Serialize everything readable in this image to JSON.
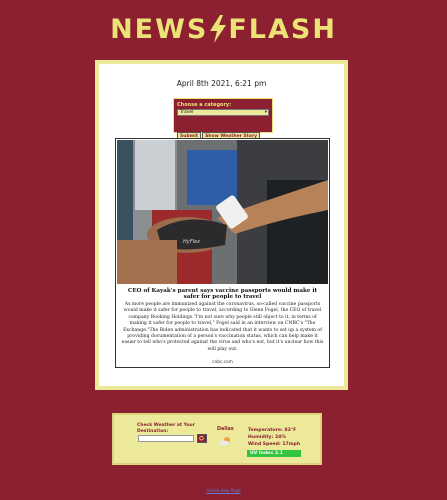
{
  "brand": {
    "left": "NEWS",
    "right": "FLASH",
    "color": "#ece377"
  },
  "datetime": "April 8th 2021, 6:21 pm",
  "category": {
    "label": "Choose a category:",
    "selected": "Travel",
    "submit_label": "Submit",
    "weather_story_label": "Show Weather Story"
  },
  "article": {
    "headline": "CEO of Kayak's parent says vaccine passports would make it safer for people to travel",
    "body": "As more people are immunized against the coronavirus, so-called vaccine passports would make it safer for people to travel, according to Glenn Fogel, the CEO of travel company Booking Holdings.\"I'm not sure why people still object to it, in terms of making it safer for people to travel,\" Fogel said in an interview on CNBC's \"The Exchange.\"The Biden administration has indicated that it wants to set up a system of providing documentation of a person's vaccination status, which can help make it easier to tell who's protected against the virus and who's not, but it's unclear how this will play out.",
    "source": "cnbc.com",
    "image_text": "HyFlex"
  },
  "weather": {
    "label": "Check Weather at Your Destination:",
    "input_value": "",
    "city": "Dallas",
    "icon": "partly-cloudy-icon",
    "temperature": "Temperature: 83°F",
    "humidity": "Humidity: 24%",
    "wind": "Wind Speed: 17mph",
    "uv": "UV Index 2.1",
    "uv_color": "#34c43e"
  },
  "footer": {
    "link": "Admin Help Page"
  },
  "colors": {
    "background": "#8c1f30",
    "panel": "#ece99a",
    "accent": "#ece377"
  }
}
